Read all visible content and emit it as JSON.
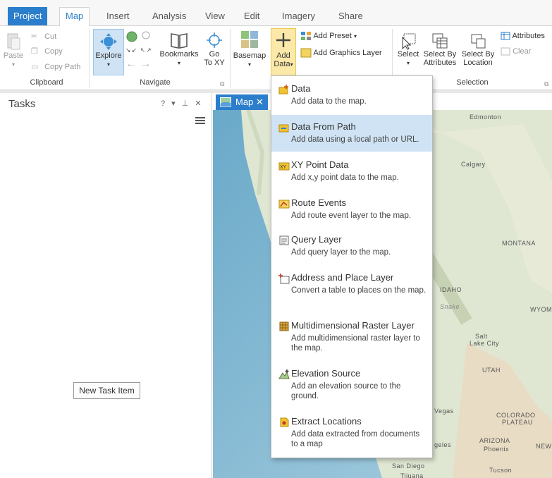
{
  "tabs": [
    "Project",
    "Map",
    "Insert",
    "Analysis",
    "View",
    "Edit",
    "Imagery",
    "Share"
  ],
  "ribbon": {
    "clipboard": {
      "paste": "Paste",
      "cut": "Cut",
      "copy": "Copy",
      "copy_path": "Copy Path",
      "label": "Clipboard"
    },
    "navigate": {
      "explore": "Explore",
      "bookmarks": "Bookmarks",
      "go_to_xy_1": "Go",
      "go_to_xy_2": "To XY",
      "label": "Navigate"
    },
    "layer": {
      "basemap": "Basemap",
      "add_data_1": "Add",
      "add_data_2": "Data",
      "add_preset": "Add Preset",
      "add_graphics": "Add Graphics Layer"
    },
    "selection": {
      "select": "Select",
      "select_by_attr_1": "Select By",
      "select_by_attr_2": "Attributes",
      "select_by_loc_1": "Select By",
      "select_by_loc_2": "Location",
      "attributes": "Attributes",
      "clear": "Clear",
      "label": "Selection"
    }
  },
  "tasks": {
    "title": "Tasks",
    "controls": "? ▾ ⊥ ✕",
    "new_task": "New Task Item"
  },
  "map": {
    "tab": "Map ✕",
    "labels": [
      "Edmonton",
      "Calgary",
      "MONTANA",
      "IDAHO",
      "WYOMI",
      "Salt",
      "Lake City",
      "UTAH",
      "COLORADO",
      "PLATEAU",
      "ARIZONA",
      "Phoenix",
      "NEW",
      "Vegas",
      "geles",
      "San Diego",
      "Tijuana",
      "Tucson",
      "Snake"
    ]
  },
  "dropdown": [
    {
      "title": "Data",
      "desc": "Add data to the map."
    },
    {
      "title": "Data From Path",
      "desc": "Add data using a local path or URL."
    },
    {
      "title": "XY Point Data",
      "desc": "Add x,y point data to the map."
    },
    {
      "title": "Route Events",
      "desc": "Add route event layer to the map."
    },
    {
      "title": "Query Layer",
      "desc": "Add query layer to the map."
    },
    {
      "title": "Address and Place Layer",
      "desc": "Convert a table to places on the map."
    },
    {
      "title": "Multidimensional Raster Layer",
      "desc": "Add multidimensional raster layer to the map."
    },
    {
      "title": "Elevation Source",
      "desc": "Add an elevation source to the ground."
    },
    {
      "title": "Extract Locations",
      "desc": "Add data extracted from documents to a map"
    }
  ],
  "colors": {
    "accent": "#2b7ecb",
    "hover": "#cfe3f4",
    "add_data_highlight": "#fce9a9"
  }
}
